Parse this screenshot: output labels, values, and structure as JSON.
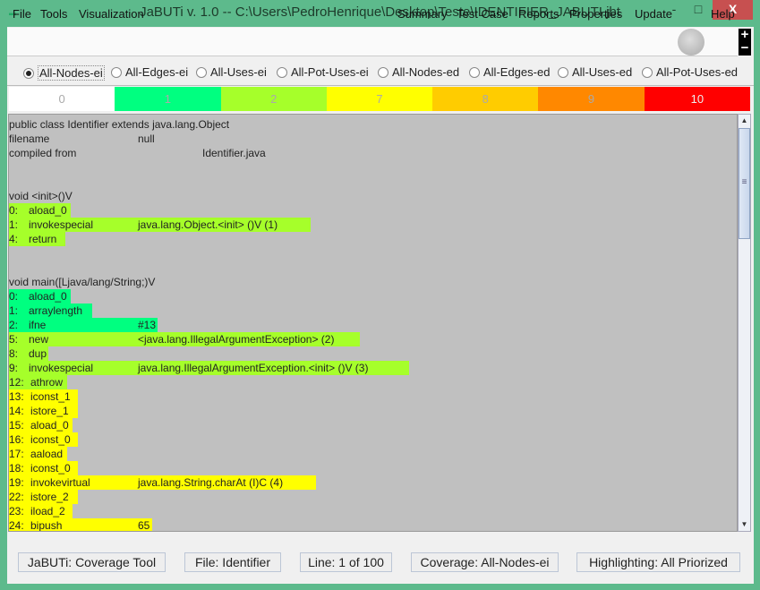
{
  "window": {
    "title": "JaBUTi v. 1.0 -- C:\\Users\\PedroHenrique\\Desktop\\Teste\\IDENTIFIER_JABUTI.jbt",
    "close": "X",
    "minimize": "-",
    "maximize": "□"
  },
  "menu": {
    "left": [
      "File",
      "Tools",
      "Visualization"
    ],
    "right": [
      "Summary",
      "Test Case",
      "Reports",
      "Properties",
      "Update",
      "Help"
    ],
    "zoom_in": "+",
    "zoom_out": "−"
  },
  "criteria": {
    "options": [
      "All-Nodes-ei",
      "All-Edges-ei",
      "All-Uses-ei",
      "All-Pot-Uses-ei",
      "All-Nodes-ed",
      "All-Edges-ed",
      "All-Uses-ed",
      "All-Pot-Uses-ed"
    ],
    "selected": "All-Nodes-ei"
  },
  "legend": [
    {
      "label": "0",
      "color": "#ffffff"
    },
    {
      "label": "1",
      "color": "#00ff80"
    },
    {
      "label": "2",
      "color": "#a6ff2a"
    },
    {
      "label": "7",
      "color": "#ffff00"
    },
    {
      "label": "8",
      "color": "#ffcc00"
    },
    {
      "label": "9",
      "color": "#ff8800"
    },
    {
      "label": "10",
      "color": "#ff0000"
    }
  ],
  "code_lines": [
    {
      "a": "public class Identifier extends java.lang.Object",
      "b": "",
      "c": "",
      "w": null
    },
    {
      "a": "filename",
      "b": "",
      "c": "null",
      "w": null
    },
    {
      "a": "compiled from",
      "b": "",
      "c": "",
      "d": "Identifier.java",
      "w": null
    },
    {
      "a": "",
      "w": null
    },
    {
      "a": "",
      "w": null
    },
    {
      "a": "void <init>()V",
      "w": null
    },
    {
      "a": "0:",
      "b": "aload_0",
      "c": "",
      "w": "2"
    },
    {
      "a": "1:",
      "b": "invokespecial",
      "c": "java.lang.Object.<init> ()V (1)",
      "w": "2"
    },
    {
      "a": "4:",
      "b": "return",
      "c": "",
      "w": "2"
    },
    {
      "a": "",
      "w": null
    },
    {
      "a": "",
      "w": null
    },
    {
      "a": "void main([Ljava/lang/String;)V",
      "w": null
    },
    {
      "a": "0:",
      "b": "aload_0",
      "c": "",
      "w": "1"
    },
    {
      "a": "1:",
      "b": "arraylength",
      "c": "",
      "w": "1"
    },
    {
      "a": "2:",
      "b": "ifne",
      "c": "#13",
      "w": "1"
    },
    {
      "a": "5:",
      "b": "new",
      "c": "<java.lang.IllegalArgumentException> (2)",
      "w": "2"
    },
    {
      "a": "8:",
      "b": "dup",
      "c": "",
      "w": "2"
    },
    {
      "a": "9:",
      "b": "invokespecial",
      "c": "java.lang.IllegalArgumentException.<init> ()V (3)",
      "w": "2"
    },
    {
      "a": "12:",
      "b": "athrow",
      "c": "",
      "w": "2"
    },
    {
      "a": "13:",
      "b": "iconst_1",
      "c": "",
      "w": "7"
    },
    {
      "a": "14:",
      "b": "istore_1",
      "c": "",
      "w": "7"
    },
    {
      "a": "15:",
      "b": "aload_0",
      "c": "",
      "w": "7"
    },
    {
      "a": "16:",
      "b": "iconst_0",
      "c": "",
      "w": "7"
    },
    {
      "a": "17:",
      "b": "aaload",
      "c": "",
      "w": "7"
    },
    {
      "a": "18:",
      "b": "iconst_0",
      "c": "",
      "w": "7"
    },
    {
      "a": "19:",
      "b": "invokevirtual",
      "c": "java.lang.String.charAt (I)C (4)",
      "w": "7"
    },
    {
      "a": "22:",
      "b": "istore_2",
      "c": "",
      "w": "7"
    },
    {
      "a": "23:",
      "b": "iload_2",
      "c": "",
      "w": "7"
    },
    {
      "a": "24:",
      "b": "bipush",
      "c": "65",
      "w": "7"
    }
  ],
  "status": [
    "JaBUTi: Coverage Tool",
    "File: Identifier",
    "Line: 1 of 100",
    "Coverage: All-Nodes-ei",
    "Highlighting: All Priorized"
  ]
}
